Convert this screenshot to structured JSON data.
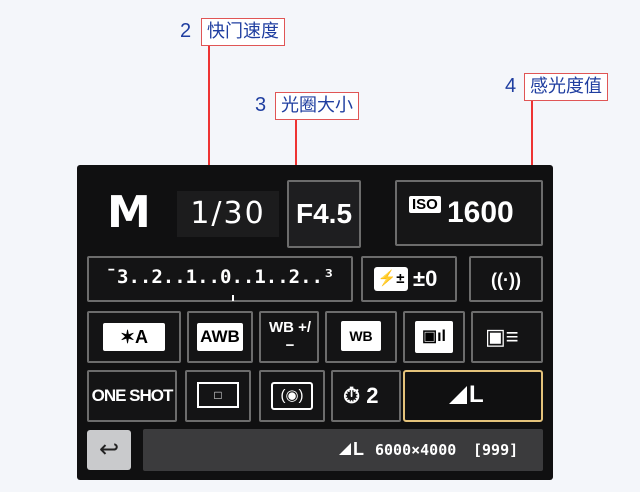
{
  "annotations": {
    "shutter": {
      "number": "2",
      "label": "快门速度"
    },
    "aperture": {
      "number": "3",
      "label": "光圈大小"
    },
    "iso": {
      "number": "4",
      "label": "感光度值"
    }
  },
  "screen": {
    "mode": "M",
    "shutter": "1/30",
    "aperture": "F4.5",
    "iso_tag": "ISO",
    "iso": "1600",
    "exposure_scale": "¯3..2..1..0..1..2..³",
    "flash_comp_icon": "⚡±",
    "flash_comp": "±0",
    "wifi": "((·)) OFF",
    "picture_style": "✶A",
    "white_balance": "AWB",
    "wb_shift": "WB +/−",
    "wb_bracket": "WB",
    "auto_lighting": "▣ıl",
    "custom_controls": "▣≡",
    "af_mode": "ONE SHOT",
    "af_area": "□",
    "metering": "(◉)",
    "drive_mode": "⏱ 2",
    "quality": "L",
    "status_quality": "L",
    "status_resolution": "6000×4000",
    "status_shots": "[999]",
    "back_icon": "↩"
  },
  "colors": {
    "annotation_text": "#1f3ea0",
    "annotation_line": "#e33333",
    "selected_border": "#e4c27a"
  }
}
